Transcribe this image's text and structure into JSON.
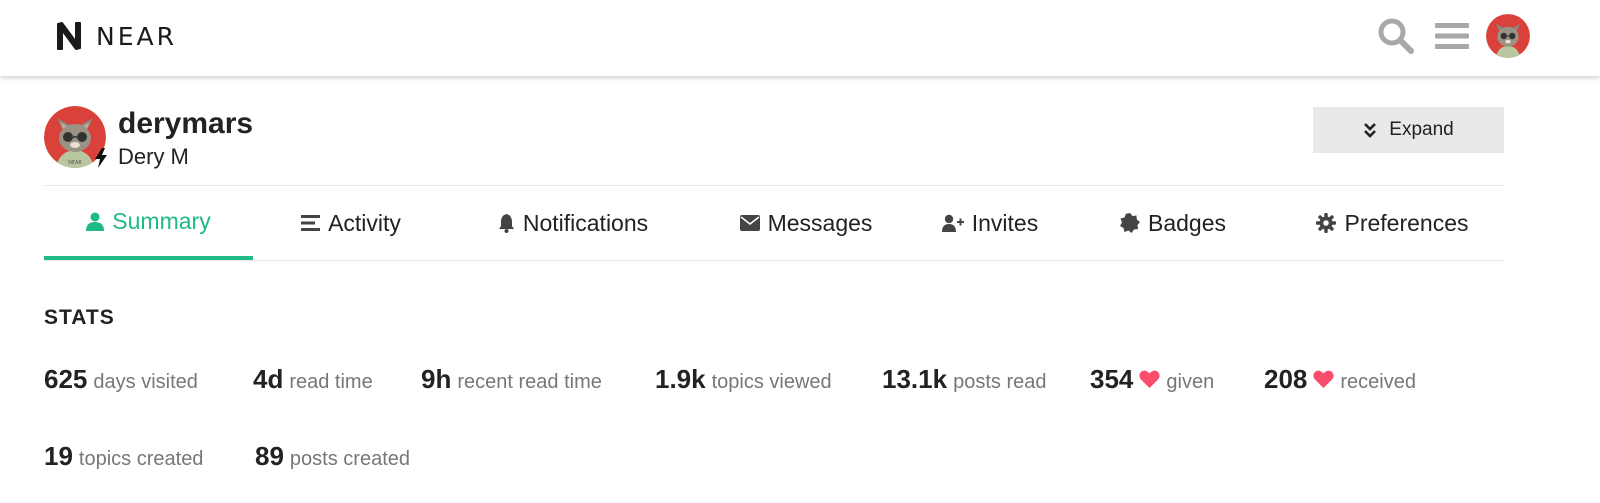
{
  "header": {
    "logo_text": "NEAR",
    "icons": [
      "search-icon",
      "hamburger-menu-icon",
      "user-avatar"
    ]
  },
  "profile": {
    "username": "derymars",
    "full_name": "Dery M",
    "expand_label": "Expand"
  },
  "nav": {
    "tabs": [
      {
        "label": "Summary",
        "icon": "user-icon",
        "active": true
      },
      {
        "label": "Activity",
        "icon": "list-icon",
        "active": false
      },
      {
        "label": "Notifications",
        "icon": "bell-icon",
        "active": false
      },
      {
        "label": "Messages",
        "icon": "envelope-icon",
        "active": false
      },
      {
        "label": "Invites",
        "icon": "user-plus-icon",
        "active": false
      },
      {
        "label": "Badges",
        "icon": "badge-icon",
        "active": false
      },
      {
        "label": "Preferences",
        "icon": "gear-icon",
        "active": false
      }
    ]
  },
  "stats": {
    "title": "STATS",
    "items": [
      {
        "value": "625",
        "label": "days visited"
      },
      {
        "value": "4d",
        "label": "read time"
      },
      {
        "value": "9h",
        "label": "recent read time"
      },
      {
        "value": "1.9k",
        "label": "topics viewed"
      },
      {
        "value": "13.1k",
        "label": "posts read"
      },
      {
        "value": "354",
        "label": "given",
        "icon": "heart-icon"
      },
      {
        "value": "208",
        "label": "received",
        "icon": "heart-icon"
      },
      {
        "value": "19",
        "label": "topics created"
      },
      {
        "value": "89",
        "label": "posts created"
      }
    ]
  },
  "colors": {
    "accent": "#1fb98a",
    "heart": "#fa4d6e",
    "avatar_bg": "#d9413a"
  }
}
